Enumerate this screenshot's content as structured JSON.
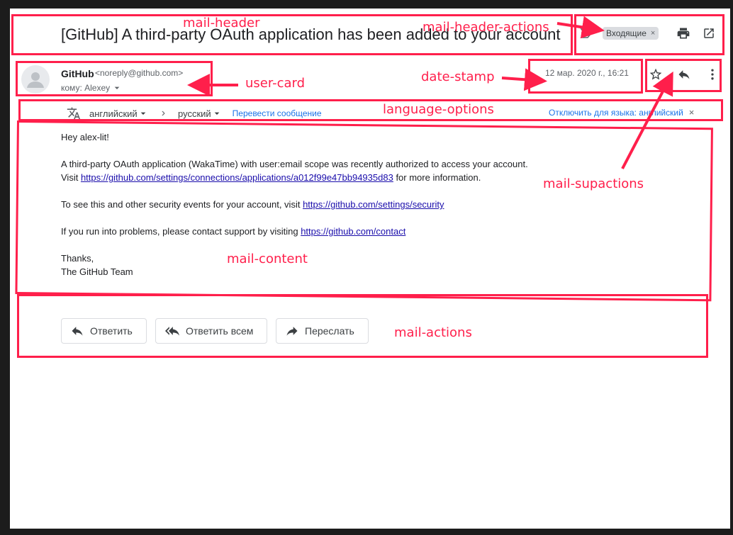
{
  "mail": {
    "subject": "[GitHub] A third-party OAuth application has been added to your account",
    "label_chip": "Входящие",
    "label_chip_close": "×",
    "sender_name": "GitHub",
    "sender_email": "<noreply@github.com>",
    "recipient": "кому: Alexey",
    "date": "12 мар. 2020 г., 16:21"
  },
  "translate": {
    "from_lang": "английский",
    "to_lang": "русский",
    "separator": "›",
    "translate_link": "Перевести сообщение",
    "disable_link": "Отключить для языка: английский",
    "disable_close": "×"
  },
  "content": {
    "greeting": "Hey alex-lit!",
    "p1_line1": "A third-party OAuth application (WakaTime) with user:email scope was recently authorized to access your account.",
    "p1_visit": "Visit ",
    "p1_link": "https://github.com/settings/connections/applications/a012f99e47bb94935d83",
    "p1_after": " for more information.",
    "p2_text": "To see this and other security events for your account, visit ",
    "p2_link": "https://github.com/settings/security",
    "p3_text": "If you run into problems, please contact support by visiting ",
    "p3_link": "https://github.com/contact",
    "thanks": "Thanks,",
    "signature": "The GitHub Team"
  },
  "actions": {
    "reply": "Ответить",
    "reply_all": "Ответить всем",
    "forward": "Переслать"
  },
  "annotations": {
    "mail_header": "mail-header",
    "mail_header_actions": "mail-header-actions",
    "user_card": "user-card",
    "date_stamp": "date-stamp",
    "language_options": "language-options",
    "mail_supactions": "mail-supactions",
    "mail_content": "mail-content",
    "mail_actions": "mail-actions"
  },
  "icons": {
    "label_marker": "label-marker-icon",
    "print": "print-icon",
    "open_new_window": "open-in-new-window-icon",
    "avatar": "avatar-icon",
    "dropdown": "chevron-down-icon",
    "translate": "translate-icon",
    "star": "star-icon",
    "reply": "reply-icon",
    "more": "more-vert-icon",
    "reply_all": "reply-all-icon",
    "forward": "forward-icon"
  },
  "colors": {
    "annotation": "#ff1f4b",
    "link": "#1a73e8",
    "body_link": "#1a0dab",
    "chip_bg": "#dadce0"
  }
}
